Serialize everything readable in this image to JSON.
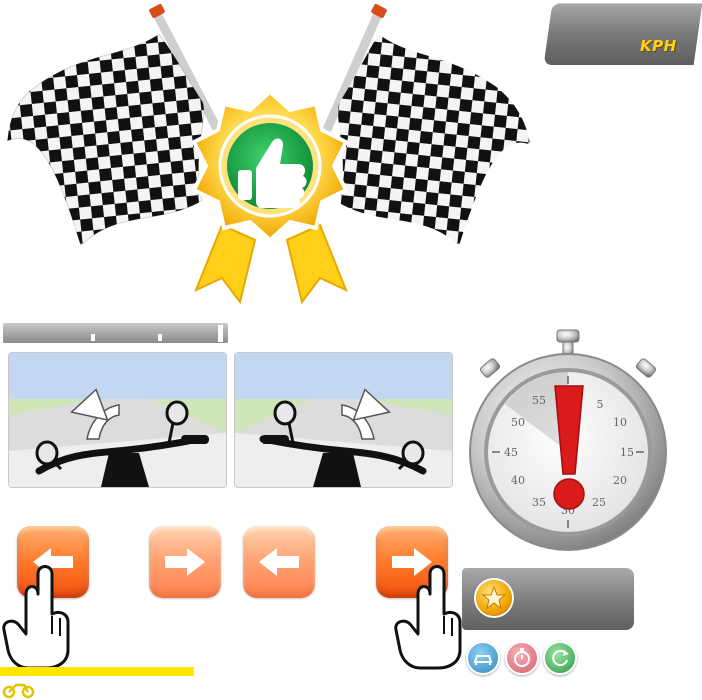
{
  "hud": {
    "speed_unit": "KPH"
  },
  "result": {
    "icon": "thumbs-up-badge-icon",
    "flags": "checkered-flag-icon"
  },
  "stopwatch": {
    "dial_labels": [
      "5",
      "10",
      "15",
      "20",
      "25",
      "30",
      "35",
      "40",
      "45",
      "50",
      "55"
    ],
    "alert_icon": "exclamation-icon"
  },
  "controls": {
    "left_icon": "arrow-left-icon",
    "right_icon": "arrow-right-icon",
    "pointer_icon": "hand-pointer-icon"
  },
  "side_buttons": [
    "car-icon",
    "timer-icon",
    "restart-icon"
  ],
  "colors": {
    "accent_orange": "#ff7a2a",
    "badge_green": "#1aa64b",
    "badge_gold": "#ffcc22",
    "alert_red": "#d91b1b",
    "label_yellow": "#ffd21a",
    "bar_yellow": "#ffe500"
  }
}
